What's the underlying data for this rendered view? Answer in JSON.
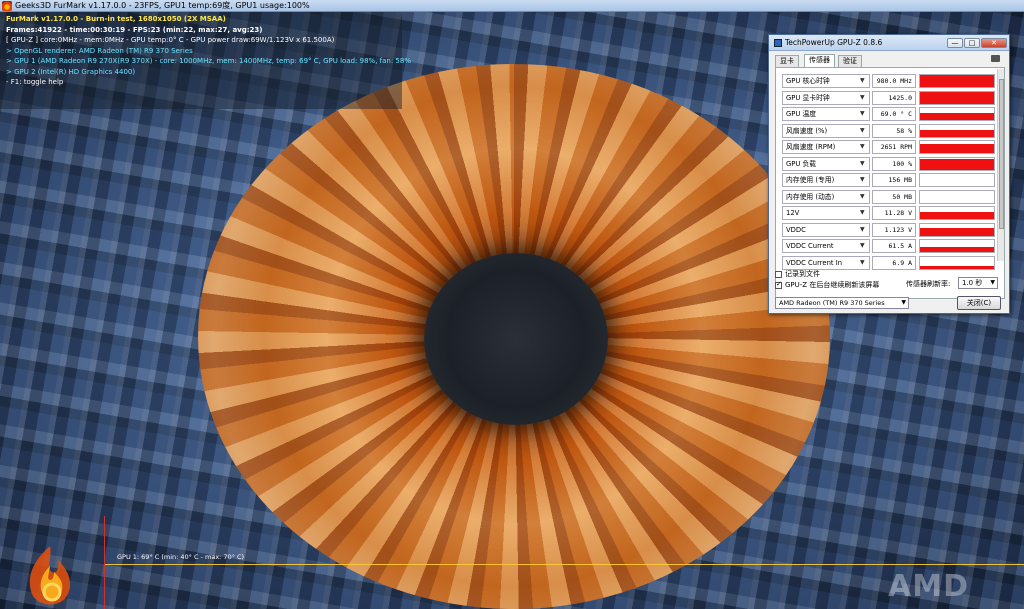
{
  "window": {
    "title": "Geeks3D FurMark v1.17.0.0 - 23FPS, GPU1 temp:69度, GPU1 usage:100%"
  },
  "hud": {
    "line1": "FurMark v1.17.0.0 - Burn-in test, 1680x1050 (2X MSAA)",
    "line2": "Frames:41922 - time:00:30:19 - FPS:23 (min:22, max:27, avg:23)",
    "line3": "[ GPU-Z ] core:0MHz - mem:0MHz - GPU temp:0° C - GPU power draw:69W/1.123V x 61.500A)",
    "line4": "> OpenGL renderer: AMD Radeon (TM) R9 370 Series",
    "line5": "> GPU 1 (AMD Radeon R9 270X(R9 370X) - core: 1000MHz, mem: 1400MHz, temp: 69° C, GPU load: 98%, fan: 58%",
    "line6": "> GPU 2 (Intel(R) HD Graphics 4400)",
    "line7": "- F1: toggle help"
  },
  "graph": {
    "label": "GPU 1: 69° C (min: 40° C - max: 70° C)",
    "line_color": "#ffcc33"
  },
  "logo": {
    "brand": "AMD"
  },
  "gpuz": {
    "title": "TechPowerUp GPU-Z 0.8.6",
    "buttons": {
      "minimize": "—",
      "maximize": "□",
      "close": "✕"
    },
    "tabs": [
      "显卡",
      "传感器",
      "验证"
    ],
    "active_tab": "传感器",
    "sensors": [
      {
        "name": "GPU 核心时钟",
        "value": "980.0 MHz",
        "fill": 1.0
      },
      {
        "name": "GPU 显卡时钟",
        "value": "1425.0 MHz",
        "fill": 1.0
      },
      {
        "name": "GPU 温度",
        "value": "69.0 ° C",
        "fill": 0.55
      },
      {
        "name": "风扇速度 (%)",
        "value": "58 %",
        "fill": 0.55
      },
      {
        "name": "风扇速度 (RPM)",
        "value": "2651 RPM",
        "fill": 0.75
      },
      {
        "name": "GPU 负载",
        "value": "100 %",
        "fill": 0.85
      },
      {
        "name": "内存使用 (专用)",
        "value": "156 MB",
        "fill": 0.0
      },
      {
        "name": "内存使用 (动态)",
        "value": "50 MB",
        "fill": 0.0
      },
      {
        "name": "12V",
        "value": "11.28 V",
        "fill": 0.6
      },
      {
        "name": "VDDC",
        "value": "1.123 V",
        "fill": 0.6
      },
      {
        "name": "VDDC Current",
        "value": "61.5 A",
        "fill": 0.45
      },
      {
        "name": "VDDC Current In",
        "value": "6.9 A",
        "fill": 0.25
      }
    ],
    "log_to_file_label": "记录到文件",
    "log_to_file_checked": false,
    "background_refresh_label": "GPU-Z 在后台继续刷新该屏幕",
    "background_refresh_checked": true,
    "refresh_rate_label": "传感器刷新率:",
    "refresh_rate_value": "1.0 秒",
    "gpu_select_value": "AMD Radeon (TM) R9 370 Series",
    "close_button": "关闭(C)",
    "bar_color": "#ee1111"
  }
}
